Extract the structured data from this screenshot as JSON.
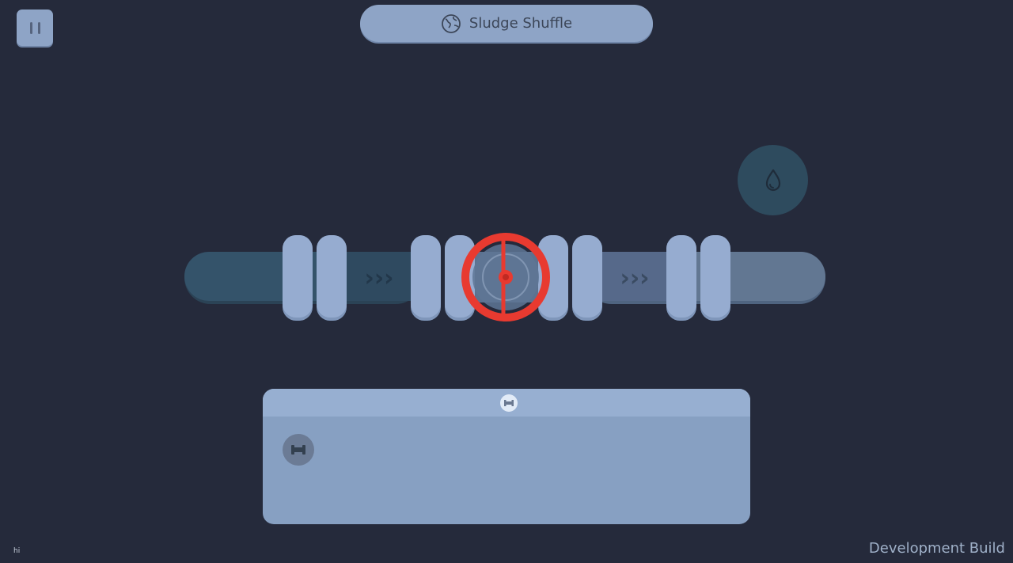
{
  "hud": {
    "pause_icon": "pause-icon",
    "level_icon": "globe-icon",
    "level_title": "Sludge Shuffle",
    "drop_icon": "water-drop-icon"
  },
  "pipe": {
    "flow_arrows": [
      "›››",
      "›››"
    ],
    "valve_icon": "valve-wheel-icon",
    "colors": {
      "pipe_left": "#34536a",
      "pipe_right": "#627792",
      "coupling": "#96acd0",
      "valve": "#e83a30"
    }
  },
  "tray": {
    "tab_icon": "pipe-segment-icon",
    "items": [
      {
        "icon": "pipe-segment-icon"
      }
    ]
  },
  "footer": {
    "debug_text": "hi",
    "build_label": "Development Build"
  }
}
